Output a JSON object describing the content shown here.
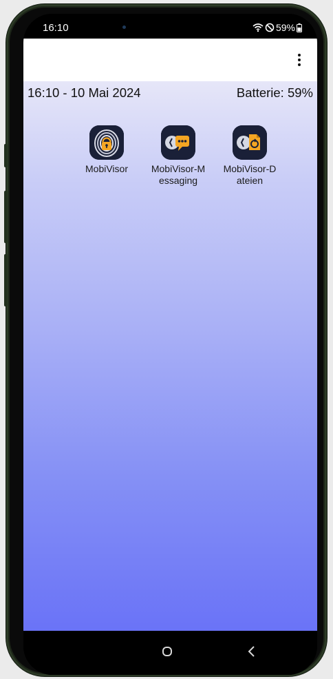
{
  "status_bar": {
    "time": "16:10",
    "battery_percent": "59%"
  },
  "app_bar": {
    "menu_icon": "more-vert-icon"
  },
  "header": {
    "datetime": "16:10 - 10 Mai 2024",
    "battery": "Batterie: 59%"
  },
  "apps": [
    {
      "label": "MobiVisor",
      "icon": "fingerprint-lock-icon"
    },
    {
      "label": "MobiVisor-Messaging",
      "icon": "chat-bubble-icon"
    },
    {
      "label": "MobiVisor-Dateien",
      "icon": "file-sync-icon"
    }
  ],
  "colors": {
    "accent_orange": "#f5a623",
    "icon_bg": "#1a2038",
    "gradient_top": "#e6e6f8",
    "gradient_bottom": "#6a73f7"
  },
  "nav_bar": {
    "home": "home-icon",
    "back": "back-icon"
  }
}
